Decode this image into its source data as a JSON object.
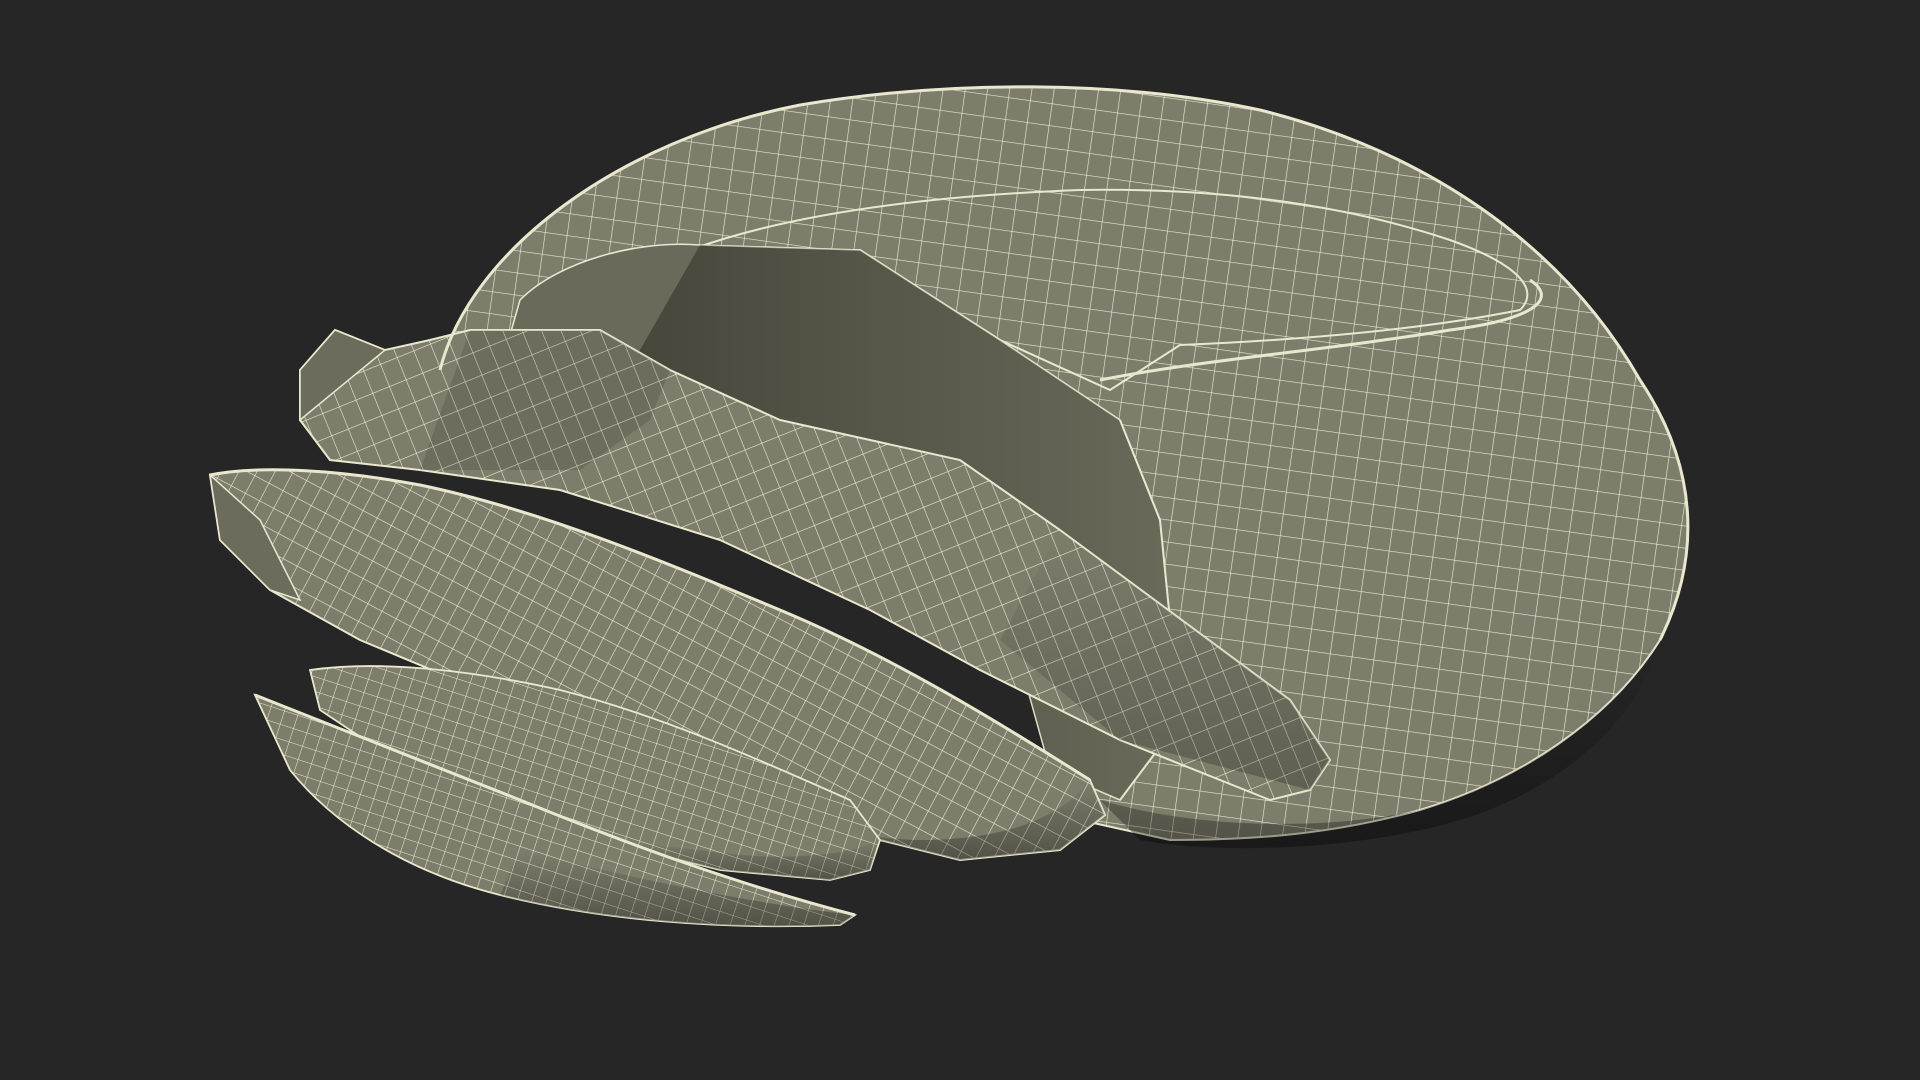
{
  "viewport": {
    "background_color": "#262626",
    "subject": "wireframe-3d-model",
    "render_style": "shaded-wireframe"
  },
  "colors": {
    "surface": "#7d7d6c",
    "surface_dark": "#5a5a4c",
    "surface_shadow": "#3e3e33",
    "wire": "#e9e8cf"
  }
}
